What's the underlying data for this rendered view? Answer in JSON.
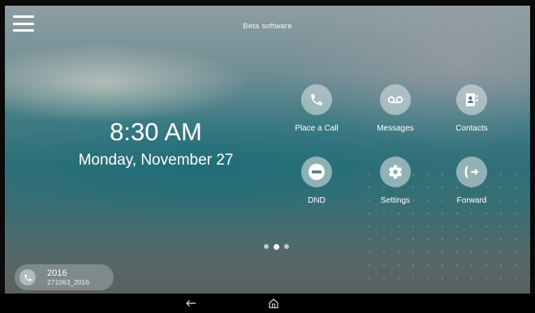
{
  "header": {
    "banner_text": "Beta software",
    "menu_icon": "hamburger-menu-icon"
  },
  "clock": {
    "time": "8:30 AM",
    "date": "Monday, November 27"
  },
  "tiles": [
    {
      "label": "Place a Call",
      "icon": "phone-icon"
    },
    {
      "label": "Messages",
      "icon": "voicemail-icon"
    },
    {
      "label": "Contacts",
      "icon": "contacts-book-icon"
    },
    {
      "label": "DND",
      "icon": "do-not-disturb-icon"
    },
    {
      "label": "Settings",
      "icon": "gear-icon"
    },
    {
      "label": "Forward",
      "icon": "call-forward-icon"
    }
  ],
  "pager": {
    "page_count": 3,
    "active_page": 2
  },
  "line": {
    "number": "2016",
    "id": "271063_2016",
    "icon": "phone-icon"
  },
  "navbar": {
    "back_icon": "back-arrow-icon",
    "home_icon": "home-icon"
  },
  "colors": {
    "tile_circle": "#e1e8e9",
    "icon_color": "#2e6f78",
    "text": "#ffffff",
    "bezel": "#000000"
  }
}
